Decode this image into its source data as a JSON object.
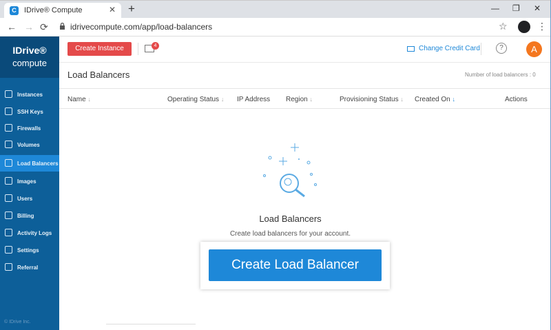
{
  "browser": {
    "tab_title": "IDrive® Compute",
    "tab_favicon_letter": "C",
    "url": "idrivecompute.com/app/load-balancers",
    "new_tab_symbol": "+",
    "close_symbol": "✕",
    "minimize_symbol": "—",
    "restore_symbol": "❐",
    "window_close_symbol": "✕",
    "back_symbol": "←",
    "forward_symbol": "→",
    "reload_symbol": "⟳",
    "star_symbol": "☆",
    "menu_symbol": "⋮"
  },
  "sidebar": {
    "logo_top": "IDrive®",
    "logo_bottom": "compute",
    "items": [
      {
        "label": "Instances",
        "icon": "instances-icon",
        "active": false
      },
      {
        "label": "SSH Keys",
        "icon": "key-icon",
        "active": false
      },
      {
        "label": "Firewalls",
        "icon": "firewall-icon",
        "active": false
      },
      {
        "label": "Volumes",
        "icon": "volume-icon",
        "active": false
      },
      {
        "label": "Load Balancers",
        "icon": "load-balancer-icon",
        "active": true
      },
      {
        "label": "Images",
        "icon": "image-icon",
        "active": false
      },
      {
        "label": "Users",
        "icon": "user-icon",
        "active": false
      },
      {
        "label": "Billing",
        "icon": "billing-icon",
        "active": false
      },
      {
        "label": "Activity Logs",
        "icon": "activity-log-icon",
        "active": false
      },
      {
        "label": "Settings",
        "icon": "settings-icon",
        "active": false
      },
      {
        "label": "Referral",
        "icon": "referral-icon",
        "active": false
      }
    ],
    "copyright": "© IDrive Inc."
  },
  "header": {
    "create_instance_label": "Create Instance",
    "notification_count": "4",
    "change_card_label": "Change Credit Card",
    "help_symbol": "?",
    "avatar_letter": "A"
  },
  "page": {
    "title": "Load Balancers",
    "count_text": "Number of load balancers : 0"
  },
  "table": {
    "columns": [
      {
        "label": "Name",
        "sortable": true,
        "active": false
      },
      {
        "label": "Operating Status",
        "sortable": true,
        "active": false
      },
      {
        "label": "IP Address",
        "sortable": false,
        "active": false
      },
      {
        "label": "Region",
        "sortable": true,
        "active": false
      },
      {
        "label": "Provisioning Status",
        "sortable": true,
        "active": false
      },
      {
        "label": "Created On",
        "sortable": true,
        "active": true
      },
      {
        "label": "Actions",
        "sortable": false,
        "active": false
      }
    ],
    "sort_arrow": "↓"
  },
  "empty_state": {
    "title": "Load Balancers",
    "subtitle": "Create load balancers for your account.",
    "cta_label": "Create Load Balancer",
    "illustration_icon": "magnifier-key-icon"
  },
  "colors": {
    "sidebar_bg": "#0d5f99",
    "sidebar_active": "#1e88d8",
    "accent": "#1e88d8",
    "danger": "#e44a4a",
    "avatar": "#f4771f"
  }
}
